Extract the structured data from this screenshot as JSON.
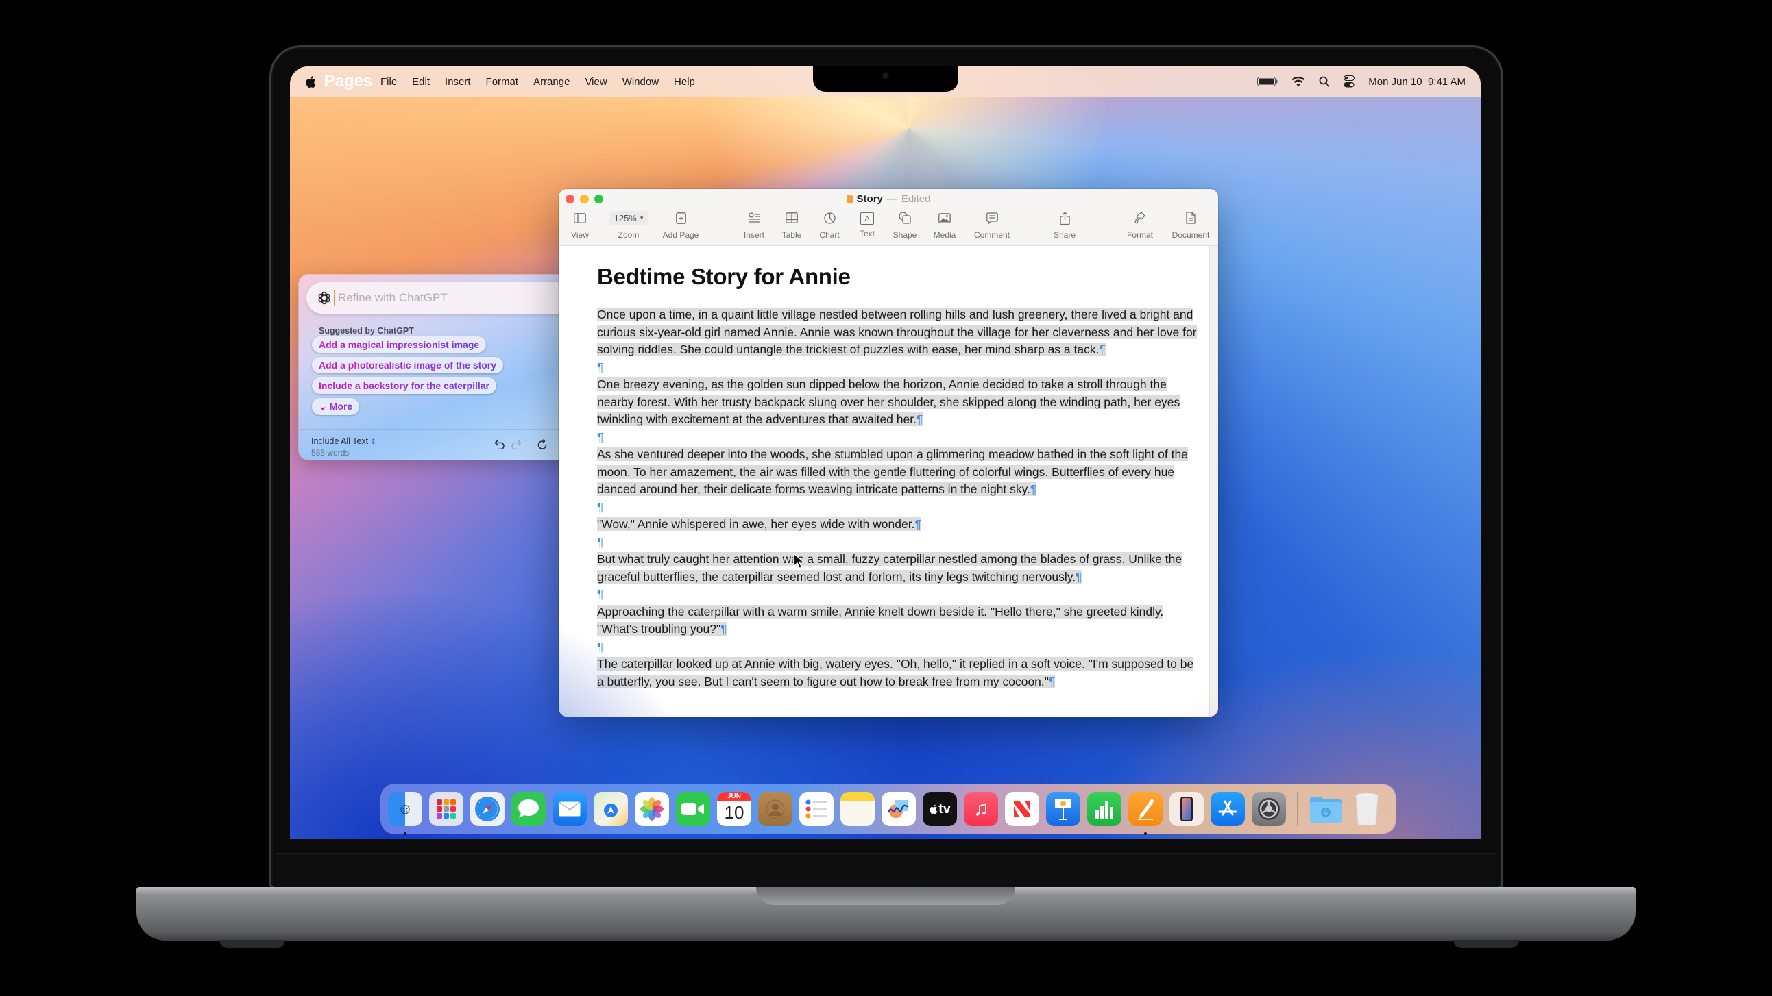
{
  "menubar": {
    "app_name": "Pages",
    "items": [
      "File",
      "Edit",
      "Insert",
      "Format",
      "Arrange",
      "View",
      "Window",
      "Help"
    ],
    "status_icons": [
      "battery-icon",
      "wifi-icon",
      "search-icon",
      "control-center-icon"
    ],
    "clock": "Mon Jun 10  9:41 AM"
  },
  "window": {
    "title": "Story",
    "title_separator": "—",
    "state": "Edited",
    "toolbar": {
      "view": "View",
      "zoom_value": "125%",
      "zoom": "Zoom",
      "add_page": "Add Page",
      "insert": "Insert",
      "table": "Table",
      "chart": "Chart",
      "text": "Text",
      "text_icon_glyph": "A",
      "shape": "Shape",
      "media": "Media",
      "comment": "Comment",
      "share": "Share",
      "format": "Format",
      "document": "Document"
    }
  },
  "document": {
    "heading": "Bedtime Story for Annie",
    "pilcrow": "¶",
    "paragraphs": [
      "Once upon a time, in a quaint little village nestled between rolling hills and lush greenery, there lived a bright and curious six-year-old girl named Annie. Annie was known throughout the village for her cleverness and her love for solving riddles. She could untangle the trickiest of puzzles with ease, her mind sharp as a tack.",
      "One breezy evening, as the golden sun dipped below the horizon, Annie decided to take a stroll through the nearby forest. With her trusty backpack slung over her shoulder, she skipped along the winding path, her eyes twinkling with excitement at the adventures that awaited her.",
      "As she ventured deeper into the woods, she stumbled upon a glimmering meadow bathed in the soft light of the moon. To her amazement, the air was filled with the gentle fluttering of colorful wings. Butterflies of every hue danced around her, their delicate forms weaving intricate patterns in the night sky.",
      "\"Wow,\" Annie whispered in awe, her eyes wide with wonder.",
      "But what truly caught her attention was a small, fuzzy caterpillar nestled among the blades of grass. Unlike the graceful butterflies, the caterpillar seemed lost and forlorn, its tiny legs twitching nervously.",
      "Approaching the caterpillar with a warm smile, Annie knelt down beside it. \"Hello there,\" she greeted kindly. \"What's troubling you?\"",
      "The caterpillar looked up at Annie with big, watery eyes. \"Oh, hello,\" it replied in a soft voice. \"I'm supposed to be a butterfly, you see. But I can't seem to figure out how to break free from my cocoon.\""
    ]
  },
  "chatgpt_panel": {
    "input_placeholder": "Refine with ChatGPT",
    "input_value": "",
    "suggested_heading": "Suggested by ChatGPT",
    "suggestions": [
      "Add a magical impressionist image",
      "Add a photorealistic image of the story",
      "Include a backstory for the caterpillar"
    ],
    "more_label": "More",
    "more_chevron": "⌄",
    "scope_label": "Include All Text",
    "scope_chevron": "⌃⌄",
    "word_count": "585 words",
    "gradient_colors": [
      "#d417b6",
      "#6a3fe0"
    ]
  },
  "dock": {
    "apps": [
      {
        "name": "Finder",
        "icon": "finder-icon",
        "running": true
      },
      {
        "name": "Launchpad",
        "icon": "launchpad-icon",
        "running": false
      },
      {
        "name": "Safari",
        "icon": "safari-icon",
        "running": false
      },
      {
        "name": "Messages",
        "icon": "messages-icon",
        "running": false
      },
      {
        "name": "Mail",
        "icon": "mail-icon",
        "running": false
      },
      {
        "name": "Maps",
        "icon": "maps-icon",
        "running": false
      },
      {
        "name": "Photos",
        "icon": "photos-icon",
        "running": false
      },
      {
        "name": "FaceTime",
        "icon": "facetime-icon",
        "running": false
      },
      {
        "name": "Calendar",
        "icon": "calendar-icon",
        "running": false,
        "month": "JUN",
        "day": "10"
      },
      {
        "name": "Contacts",
        "icon": "contacts-icon",
        "running": false
      },
      {
        "name": "Reminders",
        "icon": "reminders-icon",
        "running": false
      },
      {
        "name": "Notes",
        "icon": "notes-icon",
        "running": false
      },
      {
        "name": "Freeform",
        "icon": "freeform-icon",
        "running": false
      },
      {
        "name": "TV",
        "icon": "tv-icon",
        "running": false,
        "label": "tv"
      },
      {
        "name": "Music",
        "icon": "music-icon",
        "running": false
      },
      {
        "name": "News",
        "icon": "news-icon",
        "running": false
      },
      {
        "name": "Keynote",
        "icon": "keynote-icon",
        "running": false
      },
      {
        "name": "Numbers",
        "icon": "numbers-icon",
        "running": false
      },
      {
        "name": "Pages",
        "icon": "pages-icon",
        "running": true
      },
      {
        "name": "iPhone Mirroring",
        "icon": "iphone-mirroring-icon",
        "running": false
      },
      {
        "name": "App Store",
        "icon": "app-store-icon",
        "running": false
      },
      {
        "name": "System Settings",
        "icon": "system-settings-icon",
        "running": false
      }
    ],
    "stacks": [
      {
        "name": "Downloads",
        "icon": "downloads-folder-icon"
      },
      {
        "name": "Trash",
        "icon": "trash-icon"
      }
    ]
  }
}
